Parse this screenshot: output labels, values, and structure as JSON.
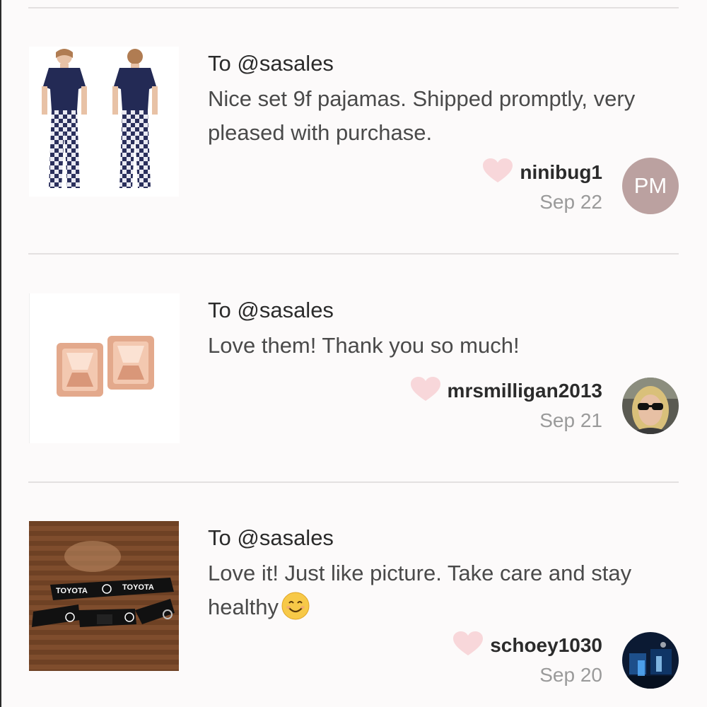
{
  "reviews": [
    {
      "to": "To @sasales",
      "message": "Nice set 9f pajamas. Shipped promptly, very pleased with purchase.",
      "username": "ninibug1",
      "date": "Sep 22",
      "avatar_initials": "PM",
      "thumbnail": "pajama-set-photo"
    },
    {
      "to": "To @sasales",
      "message": "Love them! Thank you so much!",
      "username": "mrsmilligan2013",
      "date": "Sep 21",
      "thumbnail": "earrings-photo"
    },
    {
      "to": "To @sasales",
      "message": "Love it! Just like picture. Take care and stay healthy",
      "username": "schoey1030",
      "date": "Sep 20",
      "thumbnail": "lanyard-photo",
      "lanyard_text": "TOYOTA"
    }
  ],
  "colors": {
    "heart": "#f8d7da",
    "avatar_bg": "#bba1a0",
    "background": "#fcfafa"
  }
}
